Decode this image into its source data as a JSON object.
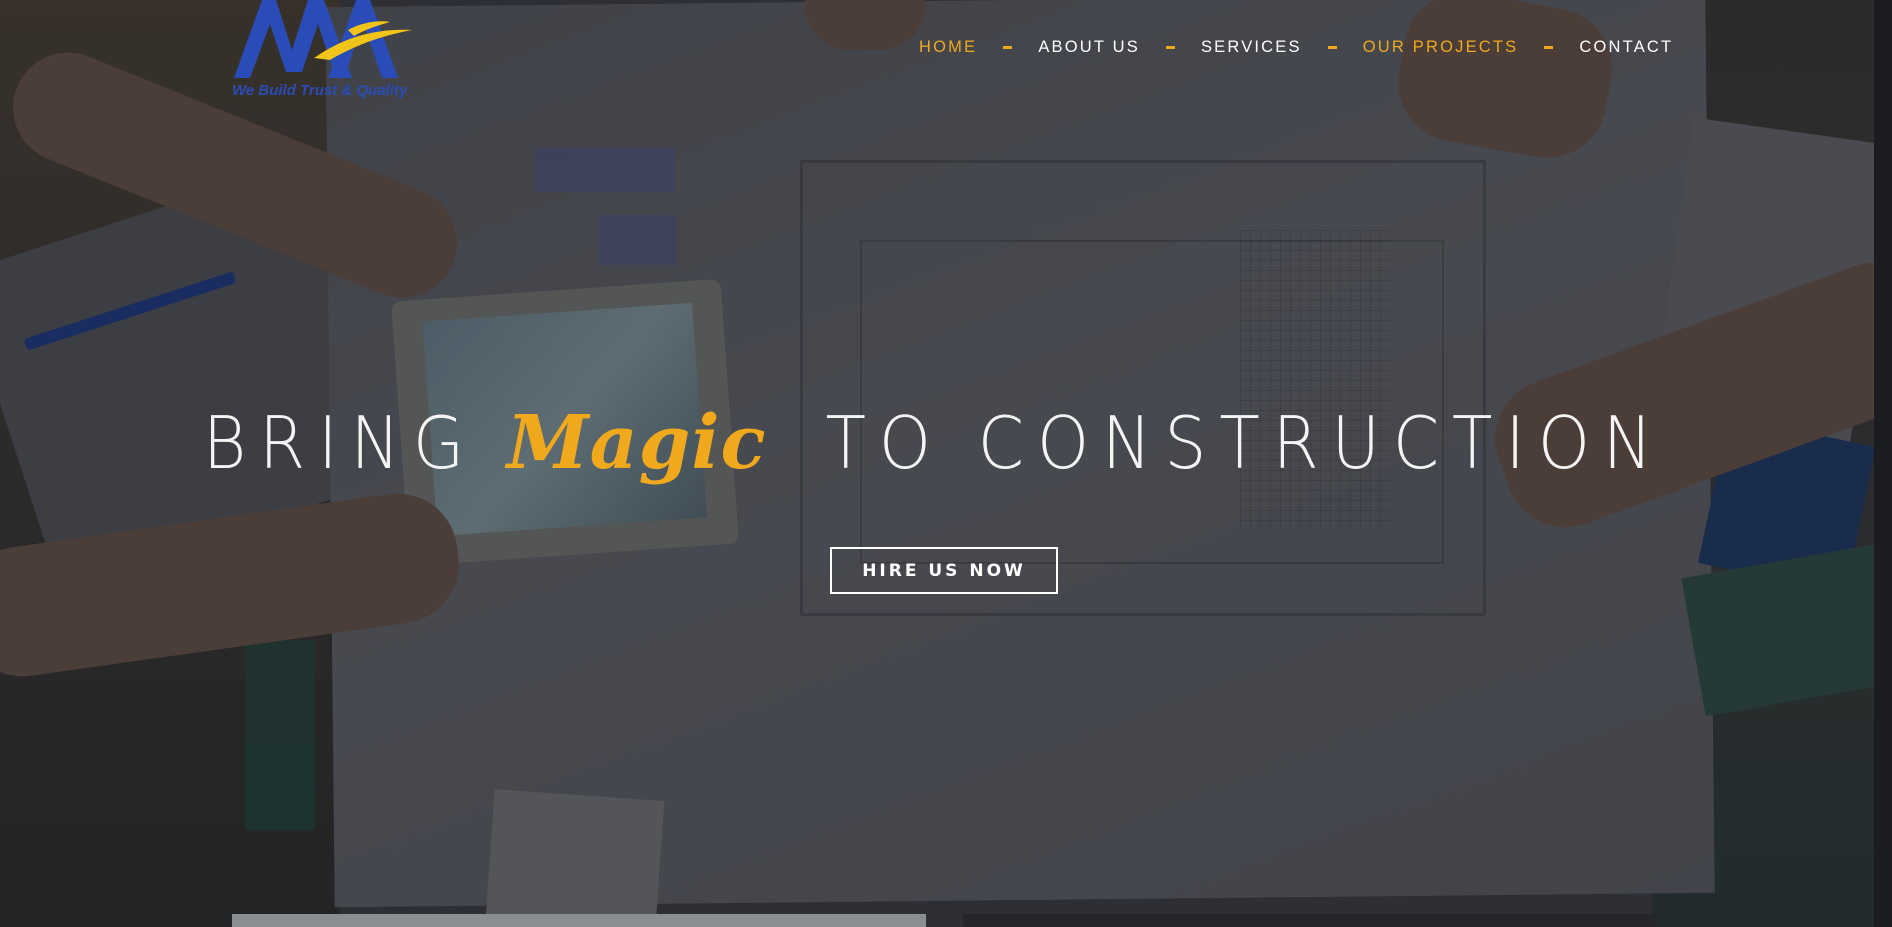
{
  "logo": {
    "tagline": "We Build Trust & Quality",
    "colors": {
      "blue": "#2a4cb8",
      "yellow": "#f0c419"
    }
  },
  "nav": {
    "items": [
      {
        "label": "HOME",
        "active": true
      },
      {
        "label": "ABOUT US",
        "active": false
      },
      {
        "label": "SERVICES",
        "active": false
      },
      {
        "label": "OUR PROJECTS",
        "active": true
      },
      {
        "label": "CONTACT",
        "active": false
      }
    ]
  },
  "hero": {
    "headline_part1": "BRING",
    "headline_accent": "Magic",
    "headline_part2": "TO CONSTRUCTION",
    "cta_label": "HIRE US NOW"
  },
  "colors": {
    "accent": "#f0a91c",
    "text": "#ffffff"
  }
}
